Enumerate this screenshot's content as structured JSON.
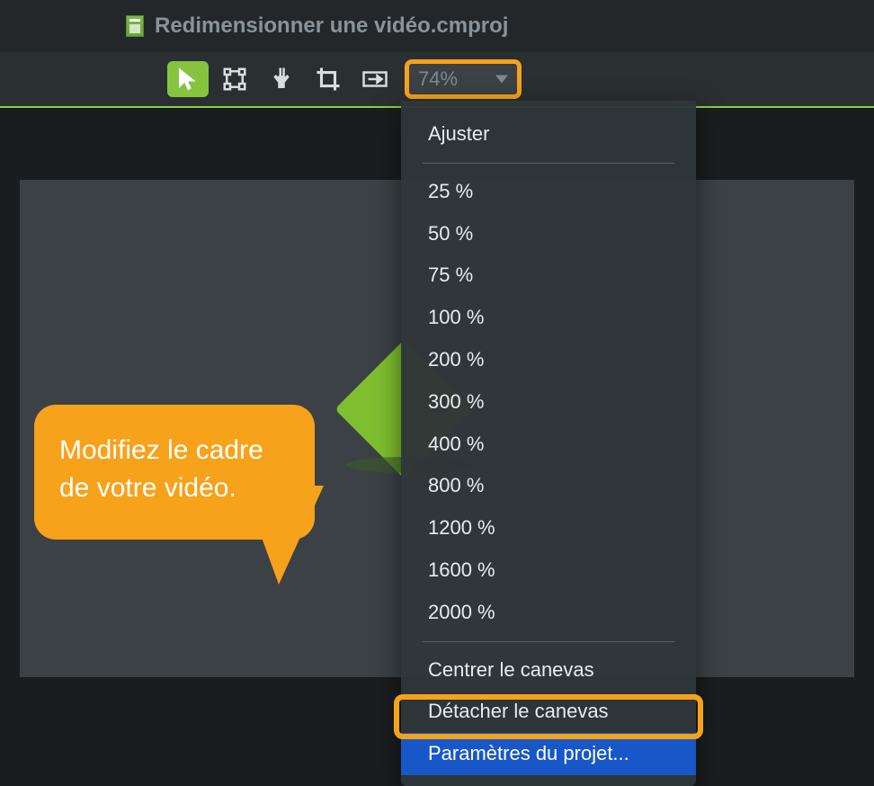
{
  "titlebar": {
    "filename": "Redimensionner une vidéo.cmproj"
  },
  "toolbar": {
    "tools": [
      "select",
      "edit-points",
      "pan",
      "crop",
      "motion"
    ],
    "zoom_value": "74%"
  },
  "zoom_menu": {
    "fit_label": "Ajuster",
    "levels": [
      "25 %",
      "50 %",
      "75 %",
      "100 %",
      "200 %",
      "300 %",
      "400 %",
      "800 %",
      "1200 %",
      "1600 %",
      "2000 %"
    ],
    "center_label": "Centrer le canevas",
    "detach_label": "Détacher le canevas",
    "settings_label": "Paramètres du projet..."
  },
  "callout": {
    "text": "Modifiez le cadre de votre vidéo."
  },
  "colors": {
    "accent_green": "#86c440",
    "highlight_orange": "#f6a21b",
    "selection_blue": "#1857c7"
  }
}
